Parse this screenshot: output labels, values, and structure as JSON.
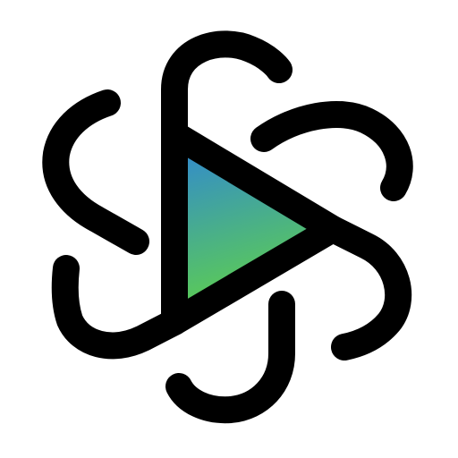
{
  "icon": {
    "name": "play-triangle-logo-icon",
    "stroke_color": "#000000",
    "background_color": "#ffffff",
    "gradient": {
      "top_color": "#2f86d6",
      "bottom_color": "#5fd14a"
    }
  }
}
